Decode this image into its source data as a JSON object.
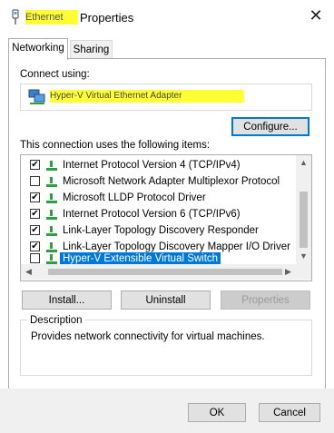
{
  "window": {
    "title_redacted": "Ethernet",
    "title_suffix": "Properties",
    "close_glyph": "✕"
  },
  "tabs": [
    {
      "label": "Networking",
      "active": true
    },
    {
      "label": "Sharing",
      "active": false
    }
  ],
  "connect_using": {
    "label": "Connect using:",
    "adapter_redacted": "Hyper-V Virtual Ethernet Adapter",
    "configure_label": "Configure..."
  },
  "items_label": "This connection uses the following items:",
  "items": [
    {
      "label": "Internet Protocol Version 4 (TCP/IPv4)",
      "checked": true,
      "selected": false
    },
    {
      "label": "Microsoft Network Adapter Multiplexor Protocol",
      "checked": false,
      "selected": false
    },
    {
      "label": "Microsoft LLDP Protocol Driver",
      "checked": true,
      "selected": false
    },
    {
      "label": "Internet Protocol Version 6 (TCP/IPv6)",
      "checked": true,
      "selected": false
    },
    {
      "label": "Link-Layer Topology Discovery Responder",
      "checked": true,
      "selected": false
    },
    {
      "label": "Link-Layer Topology Discovery Mapper I/O Driver",
      "checked": true,
      "selected": false
    },
    {
      "label": "Hyper-V Extensible Virtual Switch",
      "checked": false,
      "selected": true
    }
  ],
  "action_buttons": {
    "install": "Install...",
    "uninstall": "Uninstall",
    "properties": "Properties"
  },
  "description": {
    "legend": "Description",
    "text": "Provides network connectivity for virtual machines."
  },
  "footer": {
    "ok": "OK",
    "cancel": "Cancel"
  },
  "colors": {
    "accent": "#0078d7",
    "redaction": "#ffff33",
    "icon_green": "#2e9e44"
  },
  "icons": {
    "title": "network-connection-icon",
    "adapter": "network-adapter-icon",
    "item": "network-component-icon"
  }
}
